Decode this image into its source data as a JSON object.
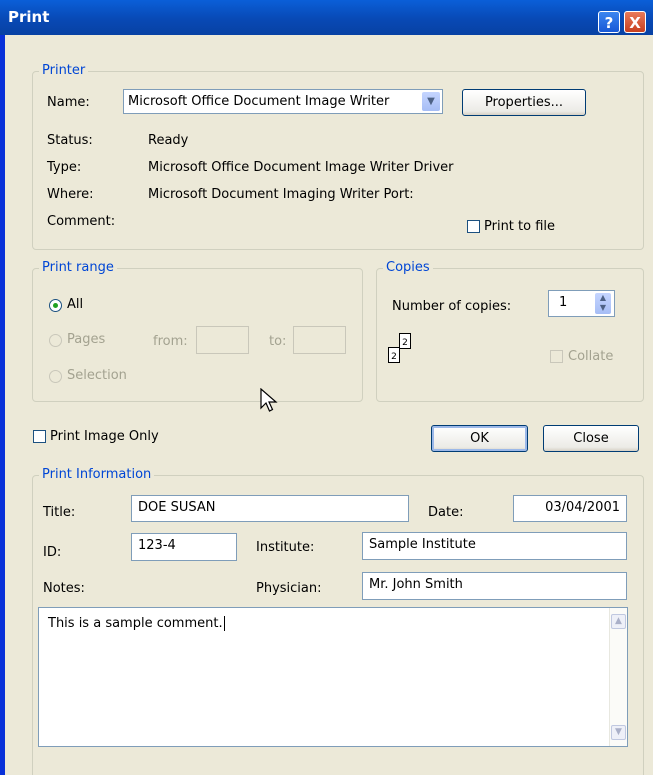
{
  "window": {
    "title": "Print",
    "help_icon": "?",
    "close_icon": "X"
  },
  "printer": {
    "legend": "Printer",
    "name_label": "Name:",
    "name_value": "Microsoft Office Document Image Writer",
    "properties_button": "Properties...",
    "status_label": "Status:",
    "status_value": "Ready",
    "type_label": "Type:",
    "type_value": "Microsoft Office Document Image Writer Driver",
    "where_label": "Where:",
    "where_value": "Microsoft Document Imaging Writer Port:",
    "comment_label": "Comment:",
    "comment_value": "",
    "print_to_file_label": "Print to file",
    "print_to_file_checked": false
  },
  "print_range": {
    "legend": "Print range",
    "all_label": "All",
    "pages_label": "Pages",
    "from_label": "from:",
    "to_label": "to:",
    "from_value": "",
    "to_value": "",
    "selection_label": "Selection",
    "selected": "All"
  },
  "copies": {
    "legend": "Copies",
    "number_label": "Number of copies:",
    "number_value": "1",
    "collate_label": "Collate",
    "collate_checked": false,
    "icon_page_1": "2",
    "icon_page_2": "2"
  },
  "print_image_only_label": "Print Image Only",
  "print_image_only_checked": false,
  "buttons": {
    "ok": "OK",
    "close": "Close"
  },
  "print_information": {
    "legend": "Print Information",
    "title_label": "Title:",
    "title_value": "DOE SUSAN",
    "date_label": "Date:",
    "date_value": "03/04/2001",
    "id_label": "ID:",
    "id_value": "123-4",
    "institute_label": "Institute:",
    "institute_value": "Sample Institute",
    "notes_label": "Notes:",
    "physician_label": "Physician:",
    "physician_value": "Mr. John Smith",
    "comment_text": "This is a sample comment."
  },
  "colors": {
    "titlebar": "#0a5fd8",
    "dialog_bg": "#ece9d8",
    "legend_text": "#0046d5",
    "disabled_text": "#a3a290"
  }
}
